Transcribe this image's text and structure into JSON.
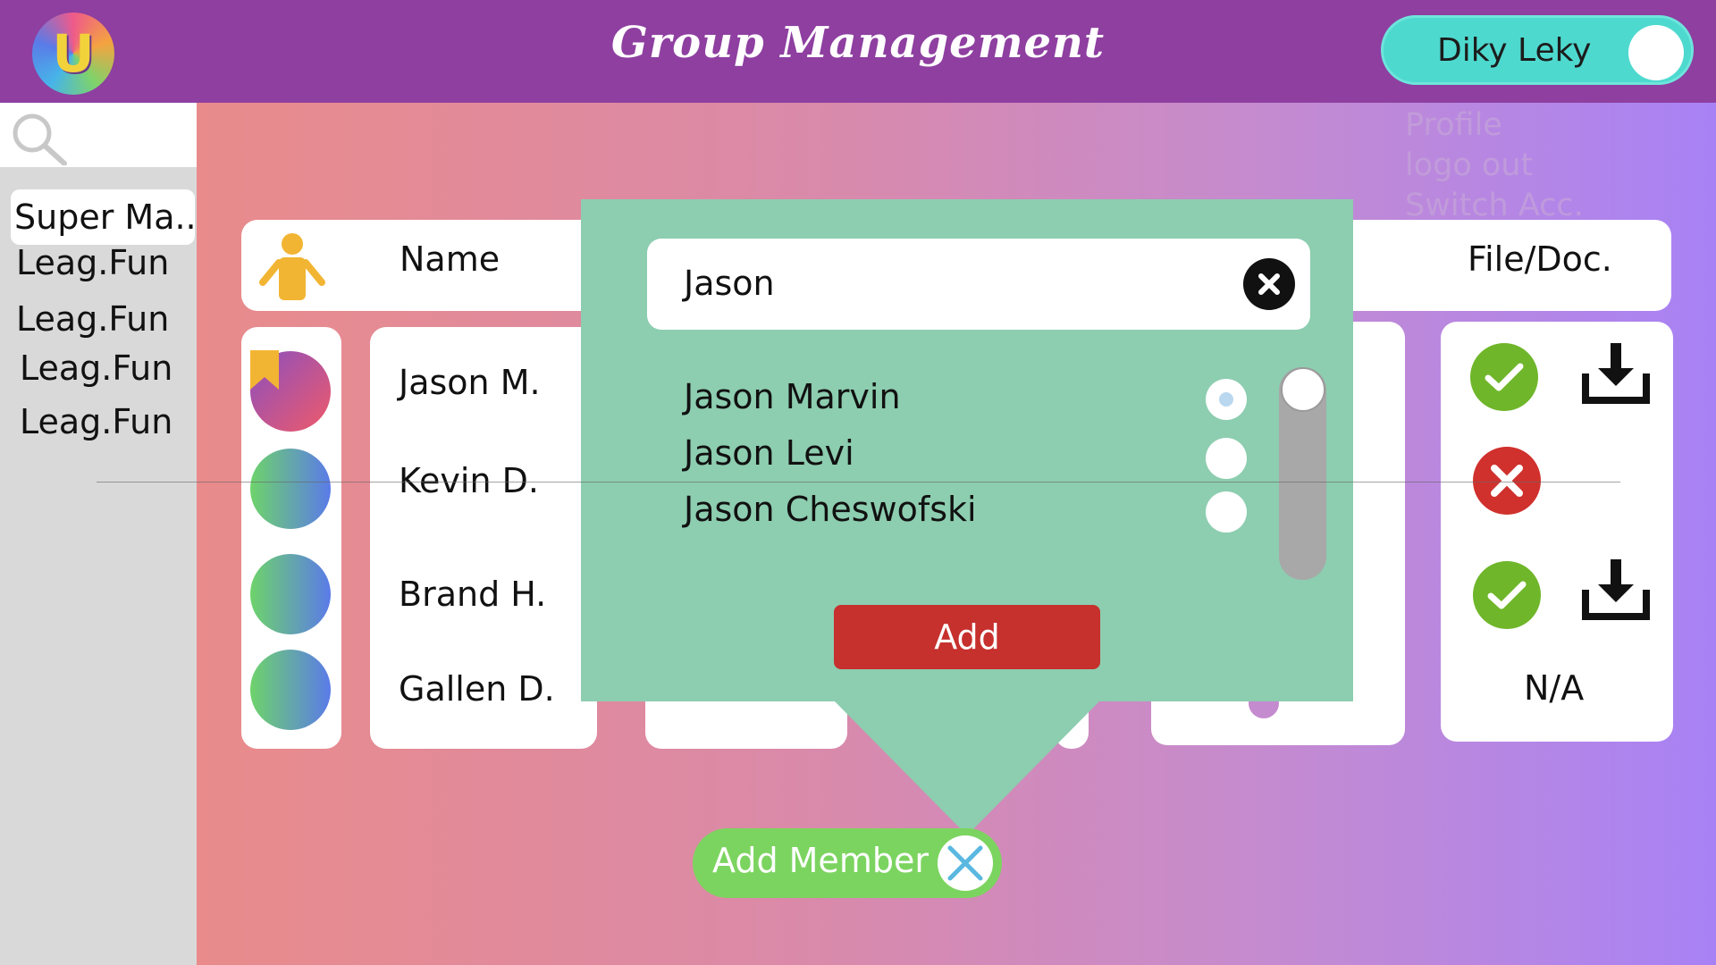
{
  "header": {
    "logo_letter": "U",
    "title": "Group Management",
    "user_name": "Diky Leky"
  },
  "profile_menu": [
    "Profile",
    "logo out",
    "Switch Acc."
  ],
  "sidebar": {
    "items": [
      {
        "label": "Super Ma.."
      },
      {
        "label": "Leag.Fun"
      },
      {
        "label": "Leag.Fun"
      },
      {
        "label": "Leag.Fun"
      },
      {
        "label": "Leag.Fun"
      }
    ]
  },
  "table": {
    "columns": {
      "name": "Name",
      "file": "File/Doc."
    },
    "members": [
      {
        "name": "Jason M.",
        "file_status": "ok",
        "download": true
      },
      {
        "name": "Kevin D.",
        "file_status": "error",
        "download": false
      },
      {
        "name": "Brand H.",
        "file_status": "ok",
        "download": true
      },
      {
        "name": "Gallen D.",
        "file_status": "none",
        "download": false,
        "file_text": "N/A"
      }
    ]
  },
  "modal": {
    "search_value": "Jason",
    "results": [
      {
        "name": "Jason Marvin",
        "selected": true
      },
      {
        "name": "Jason Levi",
        "selected": false
      },
      {
        "name": "Jason Cheswofski",
        "selected": false
      }
    ],
    "add_label": "Add"
  },
  "add_member_label": "Add Member",
  "colors": {
    "topbar": "#8e3fa0",
    "toggle": "#4ed9cf",
    "modal": "#8dcdb0",
    "add_button": "#c6302d",
    "add_member": "#7cd460",
    "status_ok": "#6fb62a",
    "status_error": "#d0312d"
  }
}
